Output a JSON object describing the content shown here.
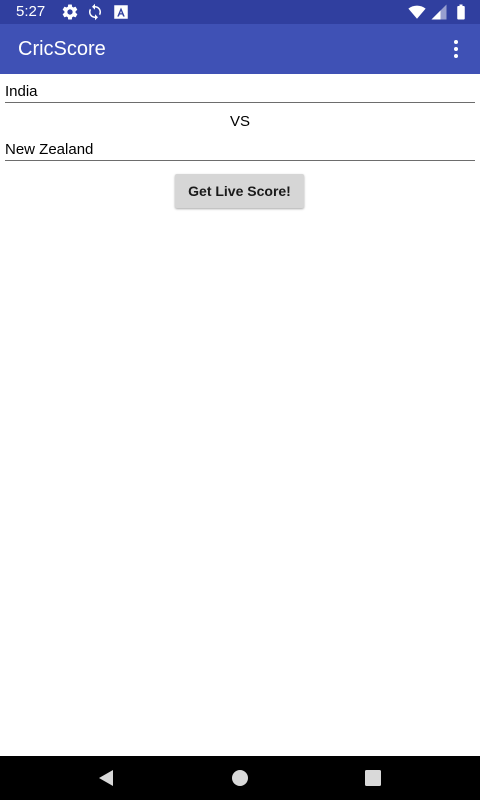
{
  "status_bar": {
    "time": "5:27",
    "icons": [
      "settings-icon",
      "sync-icon",
      "notification-icon",
      "wifi-icon",
      "signal-icon",
      "battery-icon"
    ],
    "background": "#303f9f"
  },
  "app_bar": {
    "title": "CricScore",
    "background": "#3f51b5",
    "menu_icon": "more-vert-icon"
  },
  "form": {
    "team1_value": "India",
    "vs_label": "VS",
    "team2_value": "New Zealand",
    "button_label": "Get Live Score!"
  },
  "nav_bar": {
    "buttons": [
      "back-icon",
      "home-icon",
      "recents-icon"
    ]
  }
}
